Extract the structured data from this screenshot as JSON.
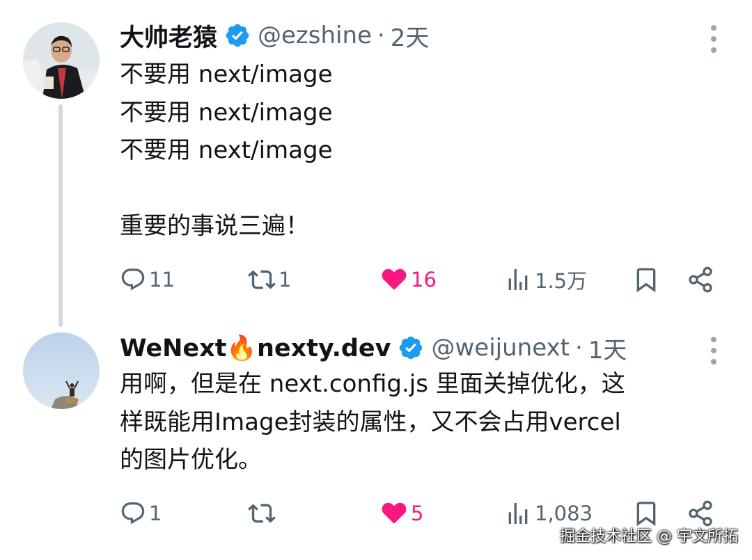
{
  "tweets": [
    {
      "author": "大帅老猿",
      "handle": "@ezshine",
      "separator": "·",
      "time": "2天",
      "lines": [
        "不要用 next/image",
        "不要用 next/image",
        "不要用 next/image",
        "",
        "重要的事说三遍！"
      ],
      "replies": "11",
      "retweets": "1",
      "likes": "16",
      "views": "1.5万"
    },
    {
      "author": "WeNext🔥nexty.dev",
      "handle": "@weijunext",
      "separator": "·",
      "time": "1天",
      "lines": [
        "用啊，但是在 next.config.js 里面关掉优化，这",
        "样既能用Image封装的属性，又不会占用vercel",
        "的图片优化。"
      ],
      "replies": "1",
      "retweets": "",
      "likes": "5",
      "views": "1,083"
    }
  ],
  "watermark": "掘金技术社区 @ 宇文所拓",
  "colors": {
    "verified": "#1d9bf0",
    "like": "#f91880",
    "secondary_text": "#536471",
    "thread_line": "#cfd9de"
  },
  "icons": [
    "verified-badge-icon",
    "more-options-icon",
    "reply-icon",
    "retweet-icon",
    "heart-icon",
    "views-icon",
    "bookmark-icon",
    "share-icon"
  ]
}
